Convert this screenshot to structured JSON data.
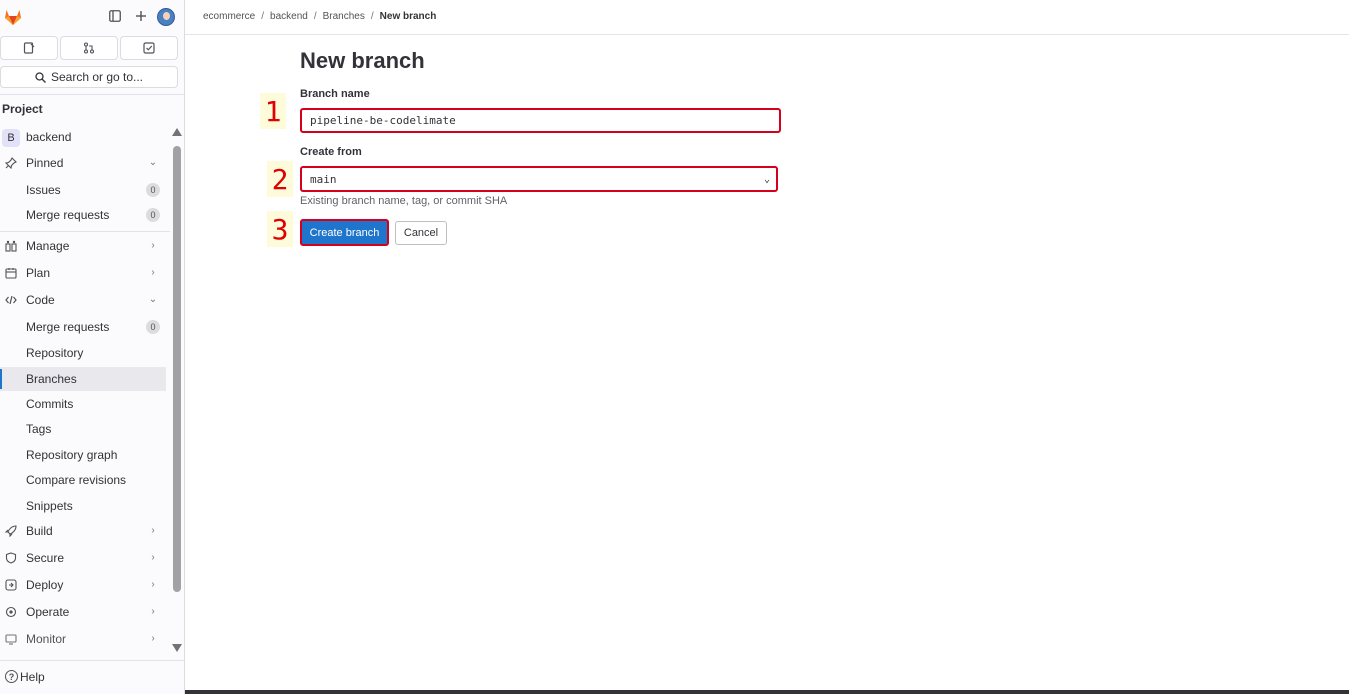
{
  "sidebar": {
    "search_label": "Search or go to...",
    "section_label": "Project",
    "project": {
      "badge": "B",
      "name": "backend"
    },
    "items": [
      {
        "label": "Pinned",
        "icon": "pin-icon",
        "chevron": "down"
      },
      {
        "label": "Issues",
        "count": "0"
      },
      {
        "label": "Merge requests",
        "count": "0"
      },
      {
        "label": "Manage",
        "icon": "manage-icon",
        "chevron": "right"
      },
      {
        "label": "Plan",
        "icon": "plan-icon",
        "chevron": "right"
      },
      {
        "label": "Code",
        "icon": "code-icon",
        "chevron": "down"
      },
      {
        "label": "Merge requests",
        "count": "0"
      },
      {
        "label": "Repository"
      },
      {
        "label": "Branches",
        "active": true
      },
      {
        "label": "Commits"
      },
      {
        "label": "Tags"
      },
      {
        "label": "Repository graph"
      },
      {
        "label": "Compare revisions"
      },
      {
        "label": "Snippets"
      },
      {
        "label": "Build",
        "icon": "rocket-icon",
        "chevron": "right"
      },
      {
        "label": "Secure",
        "icon": "shield-icon",
        "chevron": "right"
      },
      {
        "label": "Deploy",
        "icon": "deploy-icon",
        "chevron": "right"
      },
      {
        "label": "Operate",
        "icon": "operate-icon",
        "chevron": "right"
      },
      {
        "label": "Monitor",
        "icon": "monitor-icon",
        "chevron": "right"
      }
    ],
    "help_label": "Help"
  },
  "breadcrumbs": [
    "ecommerce",
    "backend",
    "Branches",
    "New branch"
  ],
  "form": {
    "title": "New branch",
    "branch_name_label": "Branch name",
    "branch_name_value": "pipeline-be-codelimate",
    "create_from_label": "Create from",
    "create_from_value": "main",
    "create_from_help": "Existing branch name, tag, or commit SHA",
    "submit_label": "Create branch",
    "cancel_label": "Cancel"
  },
  "annotations": [
    "1",
    "2",
    "3"
  ],
  "colors": {
    "accent": "#1f75cb",
    "highlight": "#d5001c",
    "annotation_bg": "#fdfbd9"
  }
}
